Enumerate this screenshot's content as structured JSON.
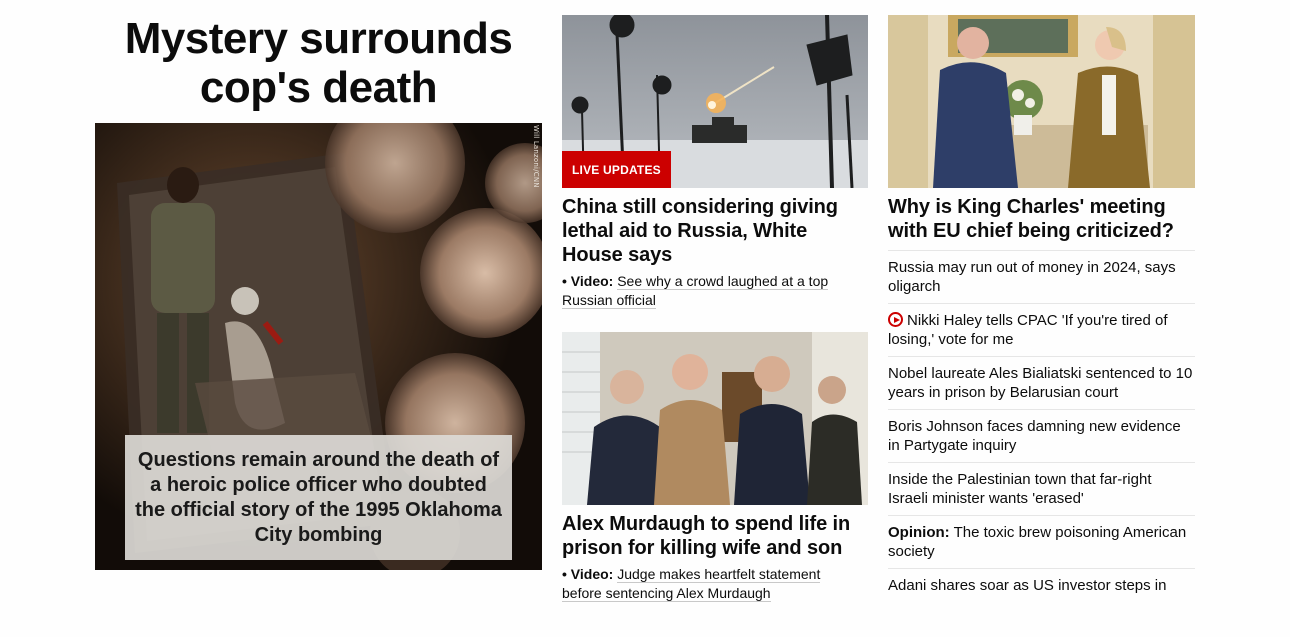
{
  "hero": {
    "headline": "Mystery surrounds cop's death",
    "caption": "Questions remain around the death of a heroic police officer who doubted the official story of the 1995 Oklahoma City bombing",
    "photo_credit": "Will Lanzoni/CNN"
  },
  "middle": {
    "story1": {
      "badge": "LIVE UPDATES",
      "headline": "China still considering giving lethal aid to Russia, White House says",
      "video_label": "• Video:",
      "video_text": "See why a crowd laughed at a top Russian official"
    },
    "story2": {
      "headline": "Alex Murdaugh to spend life in prison for killing wife and son",
      "video_label": "• Video:",
      "video_text": "Judge makes heartfelt statement before sentencing Alex Murdaugh"
    }
  },
  "right": {
    "headline": "Why is King Charles' meeting with EU chief being criticized?",
    "items": [
      {
        "prefix": "",
        "text": "Russia may run out of money in 2024, says oligarch",
        "icon": ""
      },
      {
        "prefix": "",
        "text": "Nikki Haley tells CPAC 'If you're tired of losing,' vote for me",
        "icon": "play-icon"
      },
      {
        "prefix": "",
        "text": "Nobel laureate Ales Bialiatski sentenced to 10 years in prison by Belarusian court",
        "icon": ""
      },
      {
        "prefix": "",
        "text": "Boris Johnson faces damning new evidence in Partygate inquiry",
        "icon": ""
      },
      {
        "prefix": "",
        "text": "Inside the Palestinian town that far-right Israeli minister wants 'erased'",
        "icon": ""
      },
      {
        "prefix": "Opinion:",
        "text": "The toxic brew poisoning American society",
        "icon": ""
      },
      {
        "prefix": "",
        "text": "Adani shares soar as US investor steps in",
        "icon": ""
      }
    ]
  },
  "colors": {
    "accent_red": "#cc0000",
    "text": "#0c0c0c",
    "divider": "#e6e6e6"
  }
}
